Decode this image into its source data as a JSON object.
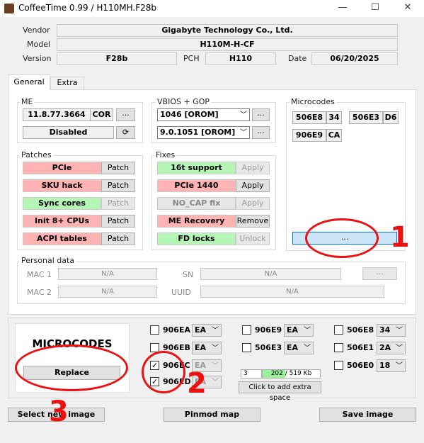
{
  "window": {
    "title": "CoffeeTime 0.99  /  H110MH.F28b",
    "minimize": "—",
    "maximize": "☐",
    "close": "✕"
  },
  "info": {
    "vendor_label": "Vendor",
    "vendor": "Gigabyte Technology Co., Ltd.",
    "model_label": "Model",
    "model": "H110M-H-CF",
    "version_label": "Version",
    "version": "F28b",
    "pch_label": "PCH",
    "pch": "H110",
    "date_label": "Date",
    "date": "06/20/2025"
  },
  "tabs": [
    {
      "label": "General"
    },
    {
      "label": "Extra"
    }
  ],
  "me": {
    "title": "ME",
    "version": "11.8.77.3664",
    "cor": "COR",
    "browse": "...",
    "state": "Disabled",
    "refresh_icon": "refresh-icon"
  },
  "vbios": {
    "title": "VBIOS + GOP",
    "vbios": "1046 [OROM]",
    "gop": "9.0.1051 [OROM]",
    "browse1": "...",
    "browse2": "..."
  },
  "microcodes": {
    "title": "Microcodes",
    "items": [
      {
        "cpu": "506E8",
        "rev": "34"
      },
      {
        "cpu": "506E3",
        "rev": "D6"
      },
      {
        "cpu": "906E9",
        "rev": "CA"
      }
    ],
    "more": "..."
  },
  "patches": {
    "title": "Patches",
    "items": [
      {
        "label": "PCIe",
        "action": "Patch"
      },
      {
        "label": "SKU hack",
        "action": "Patch"
      },
      {
        "label": "Sync cores",
        "action": "Patch"
      },
      {
        "label": "Init 8+ CPUs",
        "action": "Patch"
      },
      {
        "label": "ACPI tables",
        "action": "Patch"
      }
    ]
  },
  "fixes": {
    "title": "Fixes",
    "items": [
      {
        "label": "16t support",
        "action": "Apply"
      },
      {
        "label": "PCIe 1440",
        "action": "Apply"
      },
      {
        "label": "NO_CAP fix",
        "action": "Apply"
      },
      {
        "label": "ME Recovery",
        "action": "Remove"
      },
      {
        "label": "FD locks",
        "action": "Unlock"
      }
    ]
  },
  "personal": {
    "title": "Personal data",
    "mac1_label": "MAC 1",
    "mac1": "N/A",
    "mac2_label": "MAC 2",
    "mac2": "N/A",
    "sn_label": "SN",
    "sn": "N/A",
    "uuid_label": "UUID",
    "uuid": "N/A",
    "browse": "..."
  },
  "bottom": {
    "banner": "MICROCODES",
    "replace": "Replace",
    "col1": [
      {
        "cpu": "906EA",
        "val": "EA",
        "checked": false
      },
      {
        "cpu": "906EB",
        "val": "EA",
        "checked": false
      },
      {
        "cpu": "906EC",
        "val": "EA",
        "checked": true
      },
      {
        "cpu": "906ED",
        "val": "EA",
        "checked": true
      }
    ],
    "col2": [
      {
        "cpu": "906E9",
        "val": "EA",
        "checked": false
      },
      {
        "cpu": "506E3",
        "val": "EA",
        "checked": false
      }
    ],
    "col3": [
      {
        "cpu": "506E8",
        "val": "34",
        "checked": false
      },
      {
        "cpu": "506E1",
        "val": "2A",
        "checked": false
      },
      {
        "cpu": "506E0",
        "val": "18",
        "checked": false
      }
    ],
    "count": "3",
    "space": "202 / 519 Kb",
    "space_fraction": 0.389,
    "extra_space": "Click to add extra space"
  },
  "footer": {
    "select": "Select new image",
    "pinmod": "Pinmod map",
    "save": "Save image"
  },
  "annotations": {
    "n1": "1",
    "n2": "2",
    "n3": "3"
  },
  "colors": {
    "accent_red": "#ffb3b3",
    "accent_green": "#b5f5b5",
    "annotation": "#ee1111"
  }
}
